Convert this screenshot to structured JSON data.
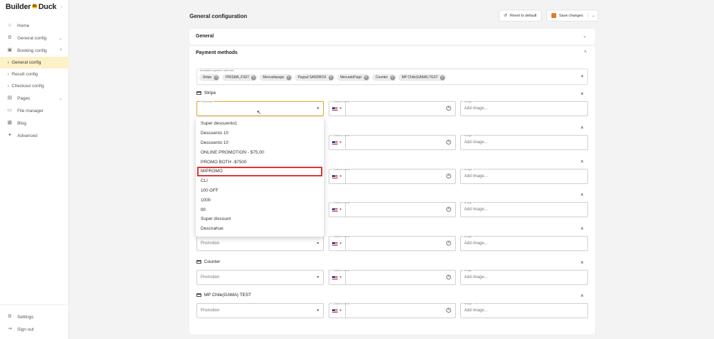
{
  "sidebar": {
    "logo": {
      "left": "Builder",
      "badge": "in",
      "right": "Duck"
    },
    "collapse_icon": "chevron-left-icon",
    "items": [
      {
        "label": "Home",
        "icon": "home-icon"
      },
      {
        "label": "General config",
        "icon": "gear-icon"
      },
      {
        "label": "Booking config",
        "icon": "calendar-icon"
      }
    ],
    "subitems": [
      {
        "label": "General config",
        "active": true
      },
      {
        "label": "Result config",
        "active": false
      },
      {
        "label": "Checkout config",
        "active": false
      }
    ],
    "items2": [
      {
        "label": "Pages",
        "icon": "pages-icon"
      },
      {
        "label": "File manager",
        "icon": "folder-icon"
      },
      {
        "label": "Blog",
        "icon": "blog-icon"
      },
      {
        "label": "Advanced",
        "icon": "rocket-icon"
      }
    ],
    "bottom": [
      {
        "label": "Settings",
        "icon": "gear-icon"
      },
      {
        "label": "Sign out",
        "icon": "sign-out-icon"
      }
    ]
  },
  "header": {
    "title": "General configuration",
    "reset_label": "Reset to default",
    "save_label": "Save changes"
  },
  "panels": {
    "general": "General",
    "payment": "Payment methods"
  },
  "available_methods": {
    "label": "Available payment methods",
    "chips": [
      "Stripe",
      "PRISMA_FS67",
      "Mercadopago",
      "Paypal SANDBOX",
      "MercadoPago",
      "Counter",
      "MP Chile(GAMA) TEST"
    ]
  },
  "fields": {
    "promotion_label": "Promotion",
    "promotion_placeholder": "Promotion",
    "custom_name_label": "Custom name",
    "image_label": "Image",
    "image_placeholder": "Add image..."
  },
  "methods": [
    {
      "name": "Stripe"
    },
    {
      "name": ""
    },
    {
      "name": ""
    },
    {
      "name": ""
    },
    {
      "name": ""
    },
    {
      "name": "Counter"
    },
    {
      "name": "MP Chile(GAMA) TEST"
    }
  ],
  "dropdown_options": [
    "Super descuento1",
    "Descuento 10",
    "Descuento 10",
    "ONLINE PROMOTION - $75,00",
    "PROMO BOTH -$7500",
    "MIPROMO",
    "CLI",
    "100 OFF",
    "1000",
    "90",
    "Super discount",
    "Descnahue"
  ],
  "colors": {
    "accent": "#f5b400",
    "active_bg": "#fdf1c8",
    "highlight_border": "#dd3333",
    "save_icon": "#e6782b"
  }
}
